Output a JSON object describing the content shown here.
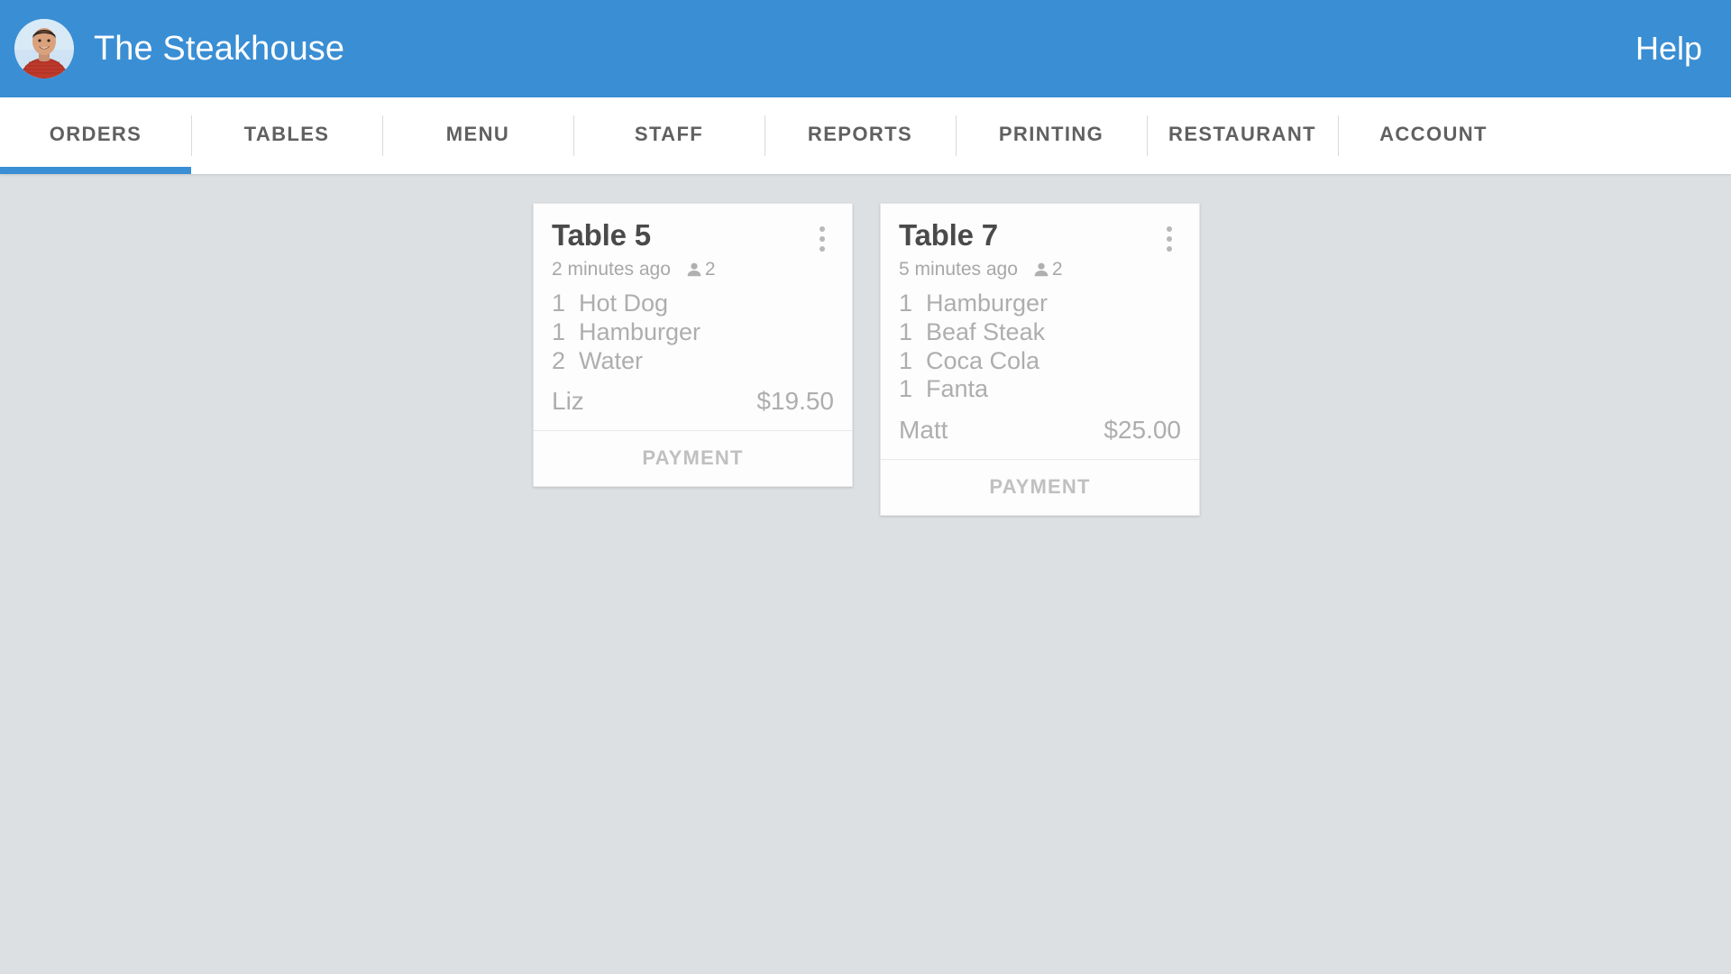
{
  "header": {
    "brand_title": "The Steakhouse",
    "avatar_alt": "user-avatar-photo",
    "help_label": "Help",
    "background_color": "#3a8ed4",
    "text_color": "#ffffff"
  },
  "nav": {
    "active_index": 0,
    "active_indicator_color": "#3a8ed4",
    "items": [
      {
        "label": "ORDERS"
      },
      {
        "label": "TABLES"
      },
      {
        "label": "MENU"
      },
      {
        "label": "STAFF"
      },
      {
        "label": "REPORTS"
      },
      {
        "label": "PRINTING"
      },
      {
        "label": "RESTAURANT"
      },
      {
        "label": "ACCOUNT"
      }
    ]
  },
  "main": {
    "background_color": "#dce0e3",
    "orders": [
      {
        "title": "Table 5",
        "time_ago": "2 minutes ago",
        "guest_count": "2",
        "items": [
          {
            "qty": "1",
            "name": "Hot Dog"
          },
          {
            "qty": "1",
            "name": "Hamburger"
          },
          {
            "qty": "2",
            "name": "Water"
          }
        ],
        "server": "Liz",
        "total": "$19.50",
        "payment_label": "PAYMENT"
      },
      {
        "title": "Table 7",
        "time_ago": "5 minutes ago",
        "guest_count": "2",
        "items": [
          {
            "qty": "1",
            "name": "Hamburger"
          },
          {
            "qty": "1",
            "name": "Beaf Steak"
          },
          {
            "qty": "1",
            "name": "Coca Cola"
          },
          {
            "qty": "1",
            "name": "Fanta"
          }
        ],
        "server": "Matt",
        "total": "$25.00",
        "payment_label": "PAYMENT"
      }
    ]
  }
}
